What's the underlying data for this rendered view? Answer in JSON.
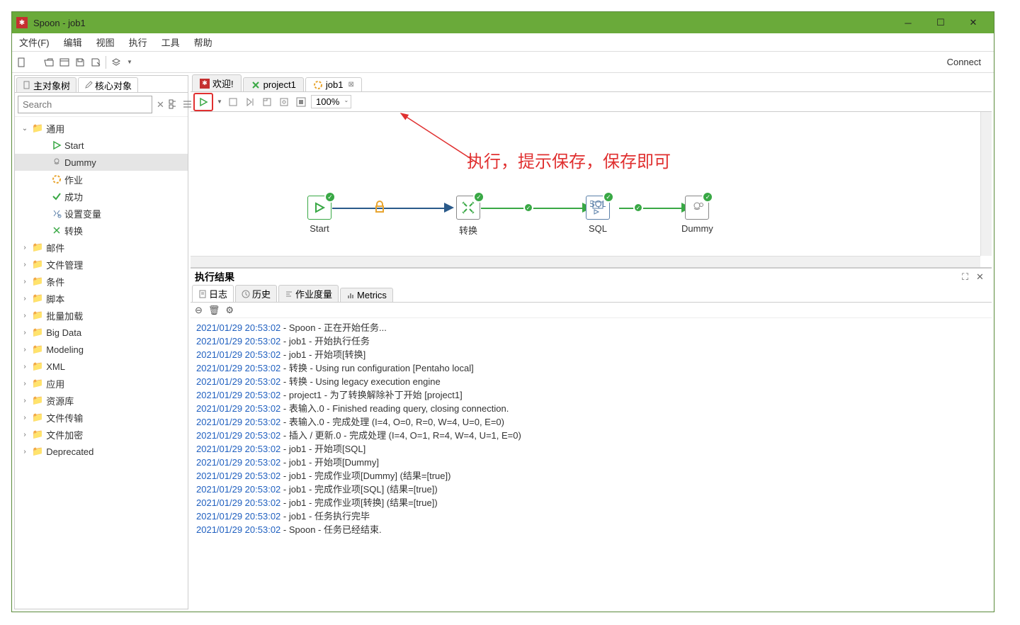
{
  "window": {
    "title": "Spoon - job1"
  },
  "menubar": [
    "文件(F)",
    "编辑",
    "视图",
    "执行",
    "工具",
    "帮助"
  ],
  "toolbar": {
    "connect": "Connect"
  },
  "sidebar": {
    "tabs": [
      "主对象树",
      "核心对象"
    ],
    "searchPlaceholder": "Search",
    "tree": {
      "root": "通用",
      "leaves": [
        {
          "label": "Start",
          "ico": "play",
          "color": "#39a845"
        },
        {
          "label": "Dummy",
          "ico": "dummy",
          "color": "#888888",
          "selected": true
        },
        {
          "label": "作业",
          "ico": "job",
          "color": "#e8a530"
        },
        {
          "label": "成功",
          "ico": "check",
          "color": "#39a845"
        },
        {
          "label": "设置变量",
          "ico": "var",
          "color": "#5a7fa8"
        },
        {
          "label": "转换",
          "ico": "trans",
          "color": "#39a845"
        }
      ],
      "folders": [
        "邮件",
        "文件管理",
        "条件",
        "脚本",
        "批量加载",
        "Big Data",
        "Modeling",
        "XML",
        "应用",
        "资源库",
        "文件传输",
        "文件加密",
        "Deprecated"
      ]
    }
  },
  "contentTabs": [
    {
      "label": "欢迎!",
      "icon": "welcome"
    },
    {
      "label": "project1",
      "icon": "trans"
    },
    {
      "label": "job1",
      "icon": "job",
      "active": true
    }
  ],
  "canvasToolbar": {
    "zoom": "100%"
  },
  "annotation": "执行，提示保存，保存即可",
  "nodes": [
    {
      "label": "Start"
    },
    {
      "label": "转换"
    },
    {
      "label": "SQL"
    },
    {
      "label": "Dummy"
    }
  ],
  "results": {
    "title": "执行结果",
    "tabs": [
      "日志",
      "历史",
      "作业度量",
      "Metrics"
    ]
  },
  "log": [
    {
      "ts": "2021/01/29 20:53:02",
      "msg": "Spoon - 正在开始任务..."
    },
    {
      "ts": "2021/01/29 20:53:02",
      "msg": "job1 - 开始执行任务"
    },
    {
      "ts": "2021/01/29 20:53:02",
      "msg": "job1 - 开始项[转换]"
    },
    {
      "ts": "2021/01/29 20:53:02",
      "msg": "转换 - Using run configuration [Pentaho local]"
    },
    {
      "ts": "2021/01/29 20:53:02",
      "msg": "转换 - Using legacy execution engine"
    },
    {
      "ts": "2021/01/29 20:53:02",
      "msg": "project1 - 为了转换解除补丁开始  [project1]"
    },
    {
      "ts": "2021/01/29 20:53:02",
      "msg": "表输入.0 - Finished reading query, closing connection."
    },
    {
      "ts": "2021/01/29 20:53:02",
      "msg": "表输入.0 - 完成处理 (I=4, O=0, R=0, W=4, U=0, E=0)"
    },
    {
      "ts": "2021/01/29 20:53:02",
      "msg": "插入 / 更新.0 - 完成处理 (I=4, O=1, R=4, W=4, U=1, E=0)"
    },
    {
      "ts": "2021/01/29 20:53:02",
      "msg": "job1 - 开始项[SQL]"
    },
    {
      "ts": "2021/01/29 20:53:02",
      "msg": "job1 - 开始项[Dummy]"
    },
    {
      "ts": "2021/01/29 20:53:02",
      "msg": "job1 - 完成作业项[Dummy] (结果=[true])"
    },
    {
      "ts": "2021/01/29 20:53:02",
      "msg": "job1 - 完成作业项[SQL] (结果=[true])"
    },
    {
      "ts": "2021/01/29 20:53:02",
      "msg": "job1 - 完成作业项[转换] (结果=[true])"
    },
    {
      "ts": "2021/01/29 20:53:02",
      "msg": "job1 - 任务执行完毕"
    },
    {
      "ts": "2021/01/29 20:53:02",
      "msg": "Spoon - 任务已经结束."
    }
  ]
}
